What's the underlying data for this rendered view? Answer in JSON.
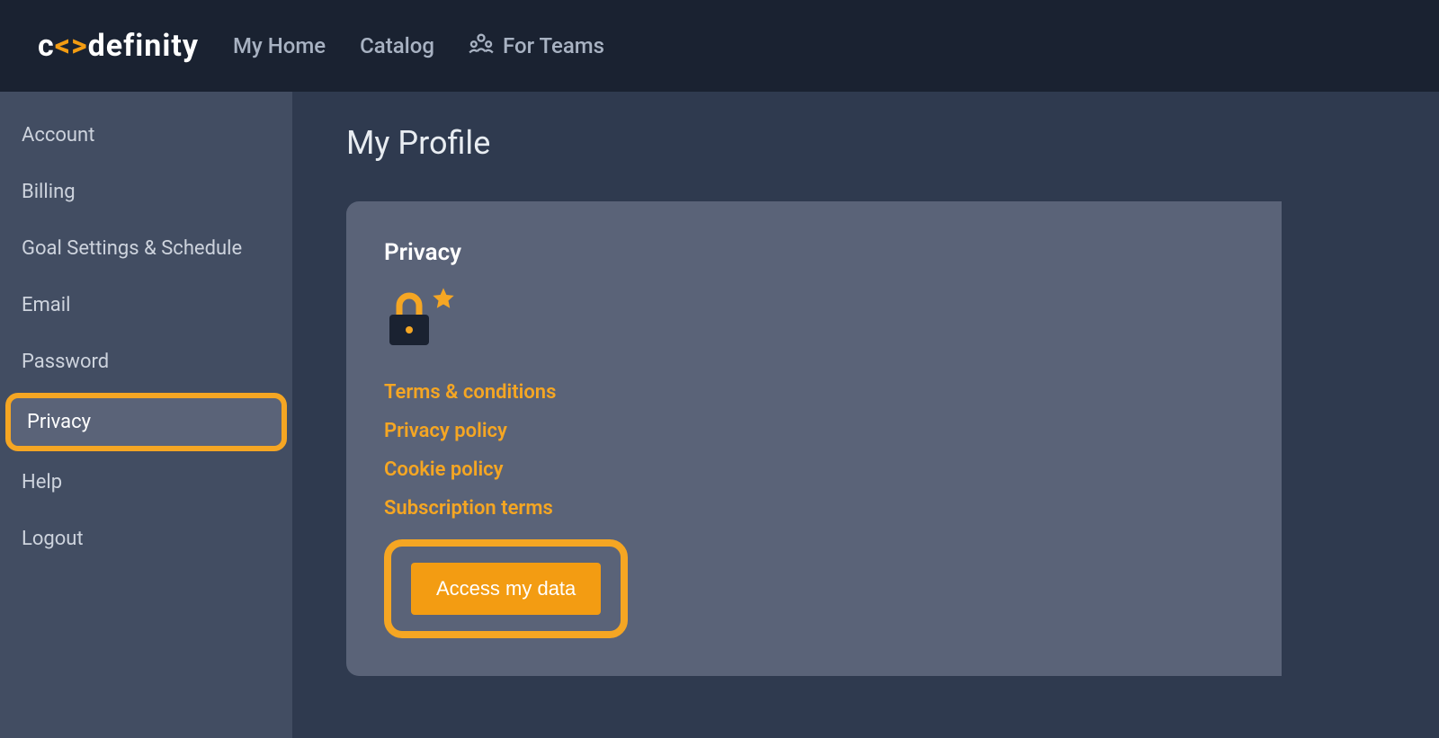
{
  "header": {
    "logo_pre": "c",
    "logo_mid_open": "<",
    "logo_mid_close": ">",
    "logo_post": "definity",
    "nav": {
      "home": "My Home",
      "catalog": "Catalog",
      "teams": "For Teams"
    }
  },
  "sidebar": {
    "items": [
      {
        "label": "Account"
      },
      {
        "label": "Billing"
      },
      {
        "label": "Goal Settings & Schedule"
      },
      {
        "label": "Email"
      },
      {
        "label": "Password"
      },
      {
        "label": "Privacy"
      },
      {
        "label": "Help"
      },
      {
        "label": "Logout"
      }
    ]
  },
  "main": {
    "title": "My Profile",
    "card": {
      "title": "Privacy",
      "links": {
        "terms": "Terms & conditions",
        "privacy": "Privacy policy",
        "cookie": "Cookie policy",
        "subscription": "Subscription terms"
      },
      "button": "Access my data"
    }
  },
  "colors": {
    "accent": "#f5a623",
    "header_bg": "#1a2231",
    "sidebar_bg": "#424d62",
    "content_bg": "#2f3a4f",
    "card_bg": "#5a6378"
  }
}
